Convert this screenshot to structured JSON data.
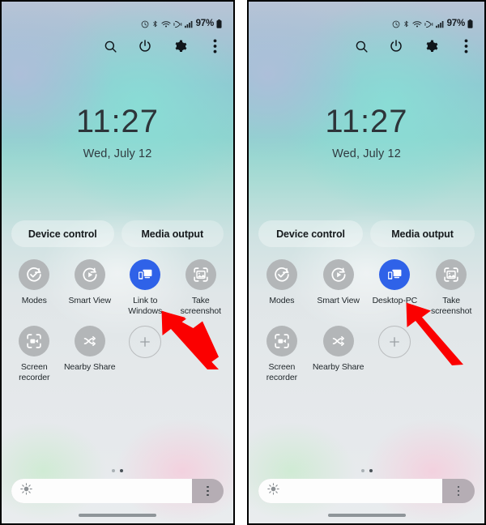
{
  "meta": {
    "panel_count": 2,
    "accent_active": "#2f62e8",
    "arrow_color": "#fb0000",
    "tile_inactive": "#b3b6b8"
  },
  "status_bar": {
    "battery_percent": "97%",
    "icons": [
      "alarm-icon",
      "bluetooth-icon",
      "wifi-calling-icon",
      "vibrate-icon",
      "signal-bars-icon",
      "battery-icon"
    ]
  },
  "header_actions": [
    {
      "name": "search-icon",
      "label": "Search"
    },
    {
      "name": "power-icon",
      "label": "Power off"
    },
    {
      "name": "gear-icon",
      "label": "Settings"
    },
    {
      "name": "more-options-icon",
      "label": "More options"
    }
  ],
  "clock": {
    "time": "11:27",
    "date": "Wed, July 12"
  },
  "pills": [
    {
      "label": "Device control"
    },
    {
      "label": "Media output"
    }
  ],
  "panels": [
    {
      "id": "left",
      "tiles_row1": [
        {
          "label": "Modes",
          "icon": "modes-icon",
          "active": false
        },
        {
          "label": "Smart View",
          "icon": "smart-view-icon",
          "active": false
        },
        {
          "label": "Link to Windows",
          "icon": "link-to-windows-icon",
          "active": true
        },
        {
          "label": "Take screenshot",
          "icon": "take-screenshot-icon",
          "active": false
        }
      ],
      "tiles_row2": [
        {
          "label": "Screen recorder",
          "icon": "screen-recorder-icon",
          "active": false
        },
        {
          "label": "Nearby Share",
          "icon": "nearby-share-icon",
          "active": false
        },
        {
          "label": "",
          "icon": "add-icon",
          "active": false,
          "add": true
        }
      ]
    },
    {
      "id": "right",
      "tiles_row1": [
        {
          "label": "Modes",
          "icon": "modes-icon",
          "active": false
        },
        {
          "label": "Smart View",
          "icon": "smart-view-icon",
          "active": false
        },
        {
          "label": "Desktop-PC",
          "icon": "link-to-windows-icon",
          "active": true
        },
        {
          "label": "Take screenshot",
          "icon": "take-screenshot-icon",
          "active": false
        }
      ],
      "tiles_row2": [
        {
          "label": "Screen recorder",
          "icon": "screen-recorder-icon",
          "active": false
        },
        {
          "label": "Nearby Share",
          "icon": "nearby-share-icon",
          "active": false
        },
        {
          "label": "",
          "icon": "add-icon",
          "active": false,
          "add": true
        }
      ]
    }
  ],
  "page_dots": {
    "count": 2,
    "active_index": 1
  },
  "brightness": {
    "icon": "brightness-icon",
    "fill_percent": "85",
    "menu_icon": "more-options-icon"
  },
  "nav": {
    "handle": "gesture-handle"
  },
  "annotations": [
    {
      "name": "red-arrow-left",
      "points_to": "Link to Windows"
    },
    {
      "name": "red-arrow-right",
      "points_to": "Desktop-PC"
    }
  ]
}
